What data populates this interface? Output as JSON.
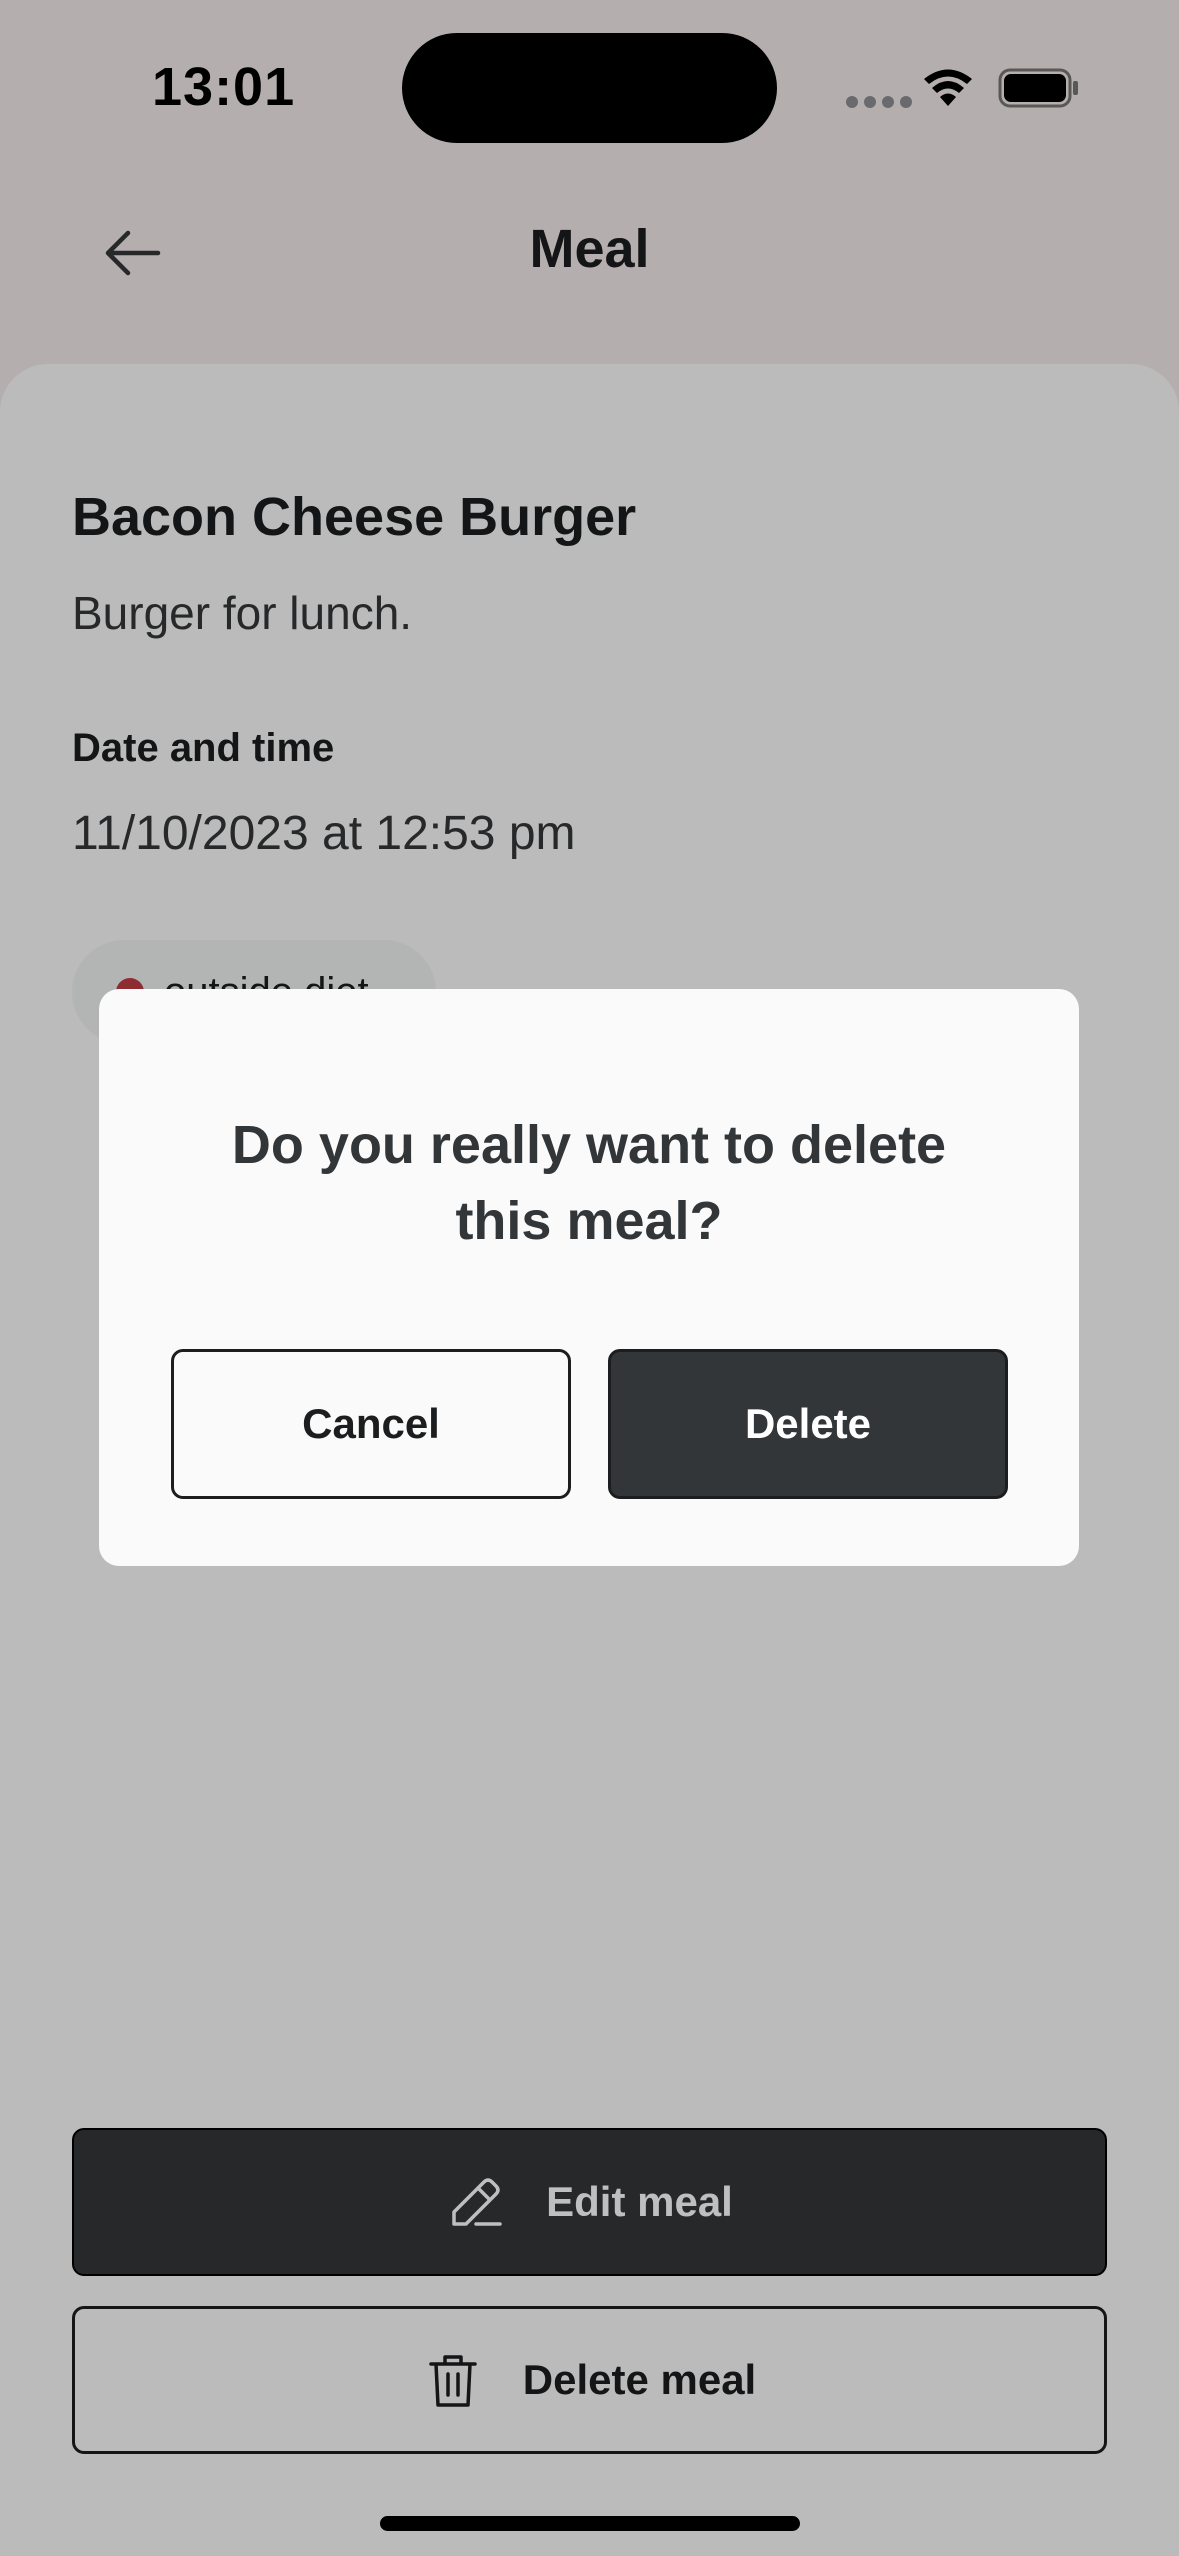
{
  "status_bar": {
    "time": "13:01"
  },
  "header": {
    "title": "Meal"
  },
  "meal": {
    "name": "Bacon Cheese Burger",
    "description": "Burger for lunch.",
    "datetime_label": "Date and time",
    "datetime_value": "11/10/2023 at 12:53 pm",
    "diet_status": "outside diet",
    "diet_status_color": "#BF3B44"
  },
  "actions": {
    "edit_label": "Edit meal",
    "edit_icon": "pencil-icon",
    "delete_label": "Delete meal",
    "delete_icon": "trash-icon"
  },
  "dialog": {
    "message": "Do you really want to delete this meal?",
    "cancel_label": "Cancel",
    "confirm_label": "Delete"
  },
  "colors": {
    "header_bg": "#F2E8EA",
    "dark_button": "#333638",
    "overlay": "rgba(0,0,0,0.25)"
  }
}
